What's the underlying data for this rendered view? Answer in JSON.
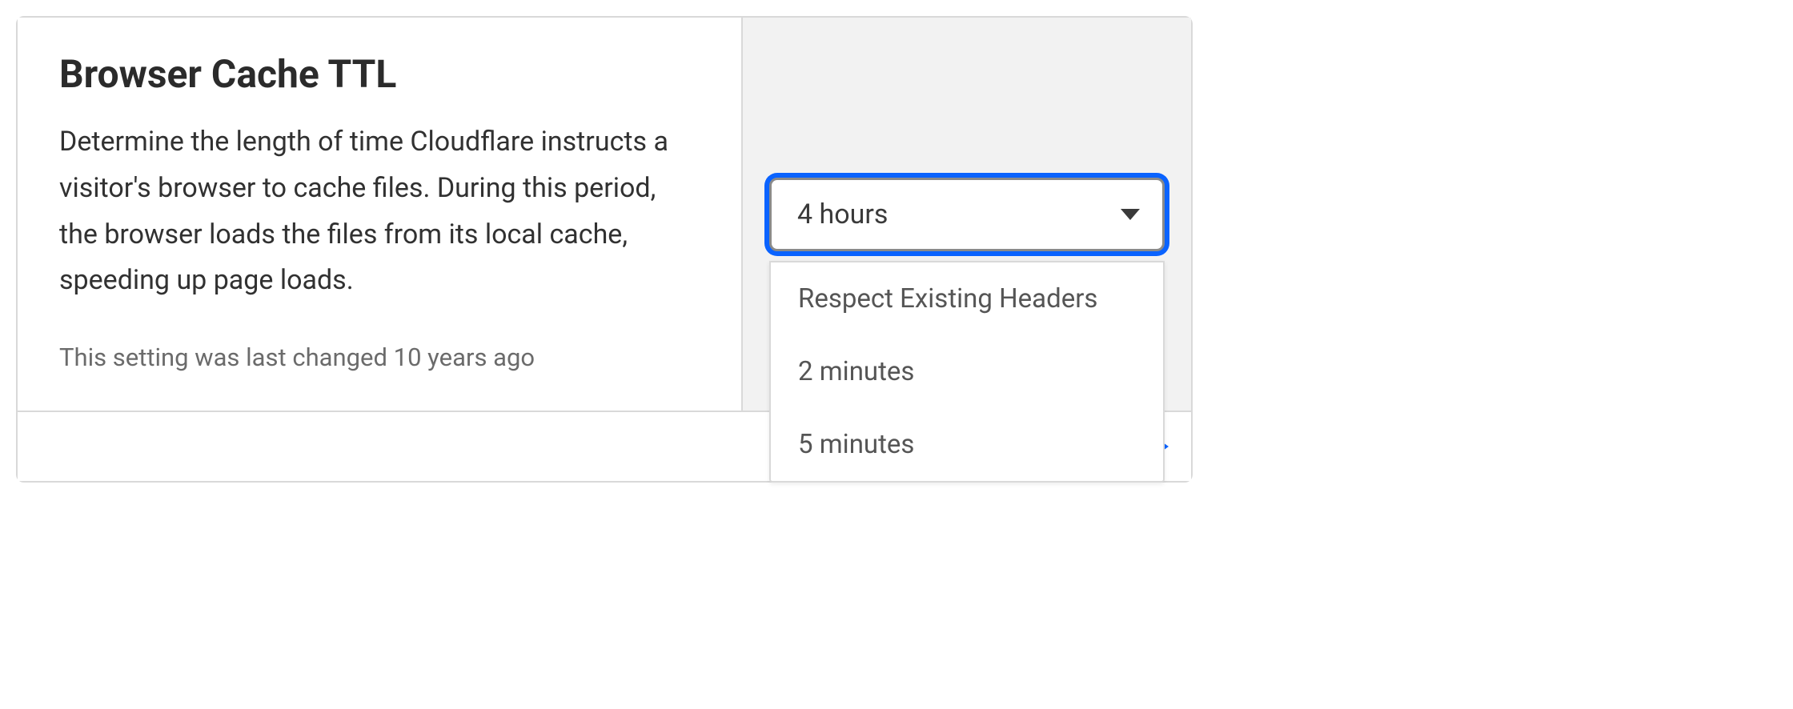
{
  "card": {
    "title": "Browser Cache TTL",
    "description": "Determine the length of time Cloudflare instructs a visitor's browser to cache files. During this period, the browser loads the files from its local cache, speeding up page loads.",
    "meta": "This setting was last changed 10 years ago"
  },
  "select": {
    "value": "4 hours",
    "options": [
      "Respect Existing Headers",
      "2 minutes",
      "5 minutes"
    ]
  }
}
